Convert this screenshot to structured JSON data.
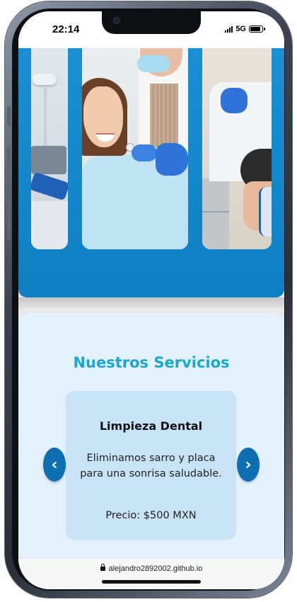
{
  "status_bar": {
    "time": "22:14",
    "network": "5G",
    "icons": [
      "signal-icon",
      "battery-icon"
    ]
  },
  "hero": {
    "images": [
      "dental-equipment-photo",
      "smiling-patient-photo",
      "dentist-patient-photo"
    ],
    "colors": {
      "background": "#1b8fd3"
    }
  },
  "services": {
    "title": "Nuestros Servicios",
    "card": {
      "title": "Limpieza Dental",
      "description": "Eliminamos sarro y placa para una sonrisa saludable.",
      "price": "Precio: $500 MXN"
    },
    "prev_label": "‹",
    "next_label": "›",
    "colors": {
      "title": "#19a6cf",
      "card": "#c8e3f6",
      "nav": "#0d6fb2",
      "section": "#e4f1fc"
    }
  },
  "browser": {
    "url": "alejandro2892002.github.io"
  }
}
